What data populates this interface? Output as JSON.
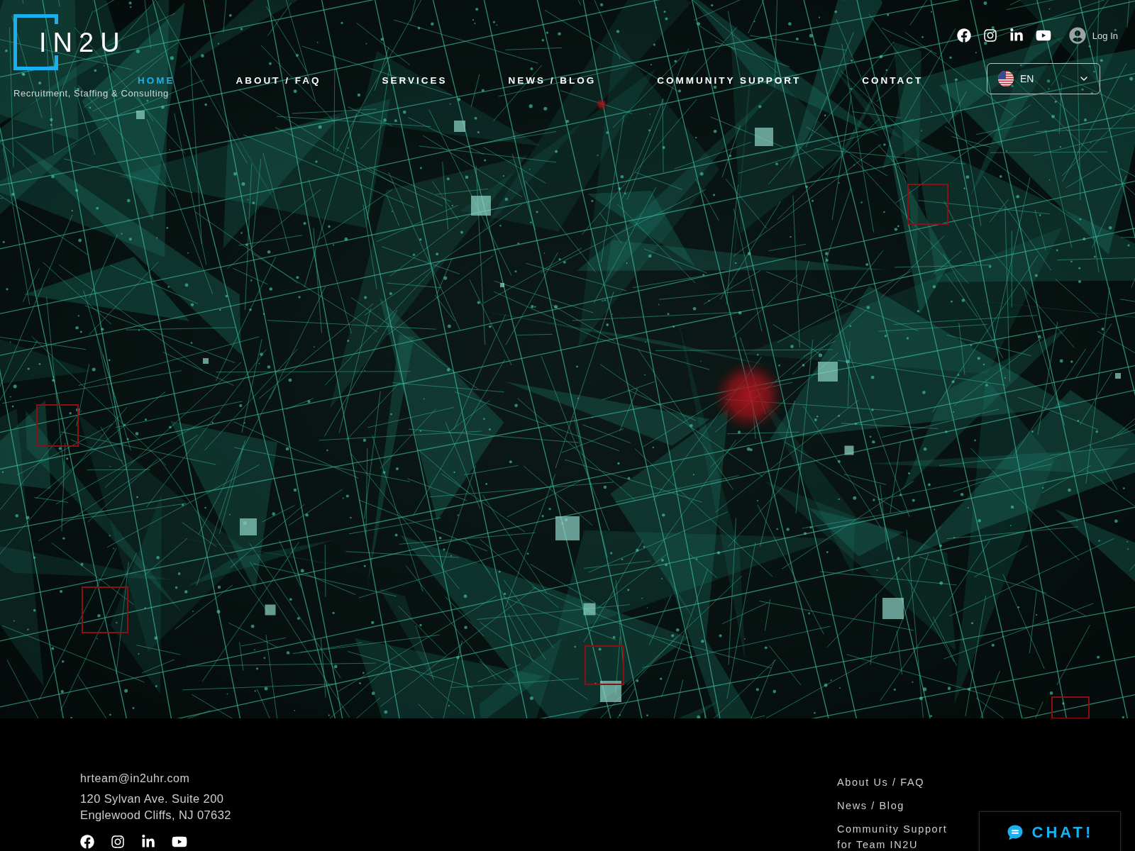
{
  "header": {
    "logo": {
      "text": "IN2U",
      "tagline": "Recruitment, Staffing & Consulting"
    },
    "nav": [
      {
        "label": "HOME",
        "selected": true
      },
      {
        "label": "ABOUT / FAQ",
        "selected": false
      },
      {
        "label": "SERVICES",
        "selected": false
      },
      {
        "label": "NEWS / BLOG",
        "selected": false
      },
      {
        "label": "COMMUNITY SUPPORT",
        "selected": false
      },
      {
        "label": "CONTACT",
        "selected": false
      }
    ],
    "login": {
      "label": "Log In"
    },
    "language": {
      "label": "EN"
    }
  },
  "footer": {
    "email": "hrteam@in2uhr.com",
    "address": [
      "120 Sylvan Ave. Suite 200",
      "Englewood Cliffs, NJ 07632"
    ],
    "links": [
      "About Us / FAQ",
      "News / Blog",
      "Community Support for Team IN2U"
    ]
  },
  "chat": {
    "label": "CHAT!"
  }
}
